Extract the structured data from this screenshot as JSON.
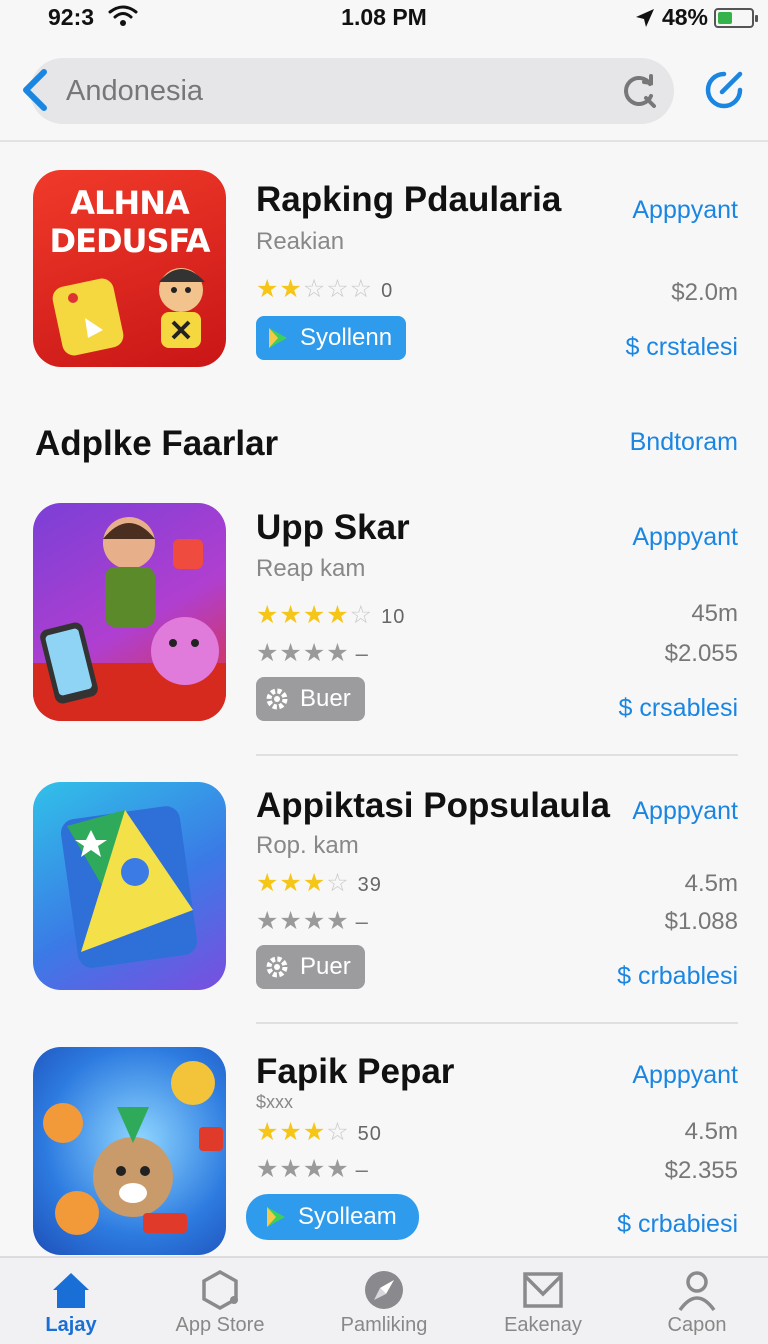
{
  "status_bar": {
    "time": "92:3",
    "clock": "1.08 PM",
    "battery": "48%"
  },
  "search": {
    "value": "Andonesia"
  },
  "featured": {
    "icon_text_line1": "ALHNA",
    "icon_text_line2": "DEDUSFA",
    "title": "Rapking Pdaularia",
    "subtitle": "Reakian",
    "rating_stars": 2,
    "rating_count": "0",
    "button_label": "Syollenn",
    "get_label": "Apppyant",
    "size": "$2.0m",
    "price_link": "$ crstalesi"
  },
  "section": {
    "title": "Adplke Faarlar",
    "link": "Bndtoram"
  },
  "apps": [
    {
      "title": "Upp Skar",
      "subtitle": "Reap kam",
      "rating_stars": 3.5,
      "rating_count": "10",
      "second_rating_dash": "–",
      "button_label": "Buer",
      "get_label": "Apppyant",
      "size": "45m",
      "price": "$2.055",
      "price_link": "$ crsablesi"
    },
    {
      "title": "Appiktasi Popsulaula",
      "subtitle": "Rop. kam",
      "rating_stars": 3,
      "rating_count": "39",
      "second_rating_dash": "–",
      "button_label": "Puer",
      "get_label": "Apppyant",
      "size": "4.5m",
      "price": "$1.088",
      "price_link": "$ crbablesi"
    },
    {
      "title": "Fapik Pepar",
      "subtitle": "$xxx",
      "rating_stars": 2.5,
      "rating_count": "50",
      "second_rating_dash": "–",
      "button_label": "Syolleam",
      "get_label": "Apppyant",
      "size": "4.5m",
      "price": "$2.355",
      "price_link": "$ crbabiesi"
    }
  ],
  "tabs": [
    {
      "label": "Lajay",
      "icon": "house-icon",
      "active": true
    },
    {
      "label": "App Store",
      "icon": "hexagon-icon",
      "active": false
    },
    {
      "label": "Pamliking",
      "icon": "compass-icon",
      "active": false
    },
    {
      "label": "Eakenay",
      "icon": "envelope-icon",
      "active": false
    },
    {
      "label": "Capon",
      "icon": "person-icon",
      "active": false
    }
  ],
  "colors": {
    "accent": "#1a86e2",
    "star": "#f5c518",
    "tab_active": "#1a6fd6"
  }
}
